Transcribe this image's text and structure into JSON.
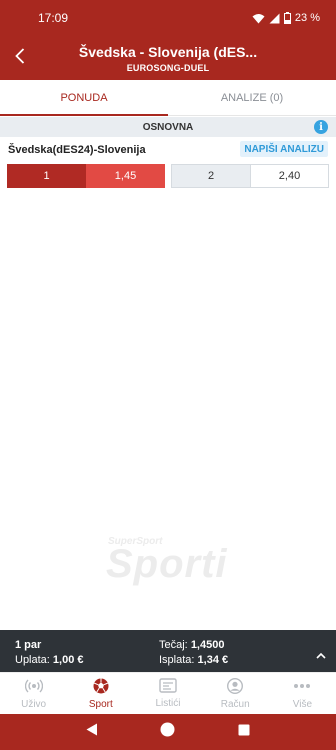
{
  "status_bar": {
    "time": "17:09",
    "battery": "23 %"
  },
  "header": {
    "title": "Švedska - Slovenija (dES...",
    "subtitle": "EUROSONG-DUEL"
  },
  "tabs": [
    {
      "label": "PONUDA",
      "active": true
    },
    {
      "label": "ANALIZE (0)",
      "active": false
    }
  ],
  "section": {
    "title": "OSNOVNA"
  },
  "match": {
    "name": "Švedska(dES24)-Slovenija",
    "analyze_label": "NAPIŠI ANALIZU",
    "odds": [
      {
        "label": "1",
        "value": "1,45",
        "selected": true
      },
      {
        "label": "2",
        "value": "2,40",
        "selected": false
      }
    ]
  },
  "watermark": {
    "small": "SuperSport",
    "big": "Sporti"
  },
  "slip": {
    "pairs": "1 par",
    "stake_label": "Uplata:",
    "stake_value": "1,00 €",
    "odds_label": "Tečaj:",
    "odds_value": "1,4500",
    "payout_label": "Isplata:",
    "payout_value": "1,34 €"
  },
  "bottom_nav": [
    {
      "label": "Uživo",
      "icon": "live-icon",
      "active": false
    },
    {
      "label": "Sport",
      "icon": "soccer-ball-icon",
      "active": true
    },
    {
      "label": "Listići",
      "icon": "ticket-icon",
      "active": false
    },
    {
      "label": "Račun",
      "icon": "account-icon",
      "active": false
    },
    {
      "label": "Više",
      "icon": "more-icon",
      "active": false
    }
  ],
  "colors": {
    "brand": "#a8281f",
    "selected_odd": "#e24a44",
    "info": "#36a3e0",
    "slip_bg": "#2e3338"
  }
}
